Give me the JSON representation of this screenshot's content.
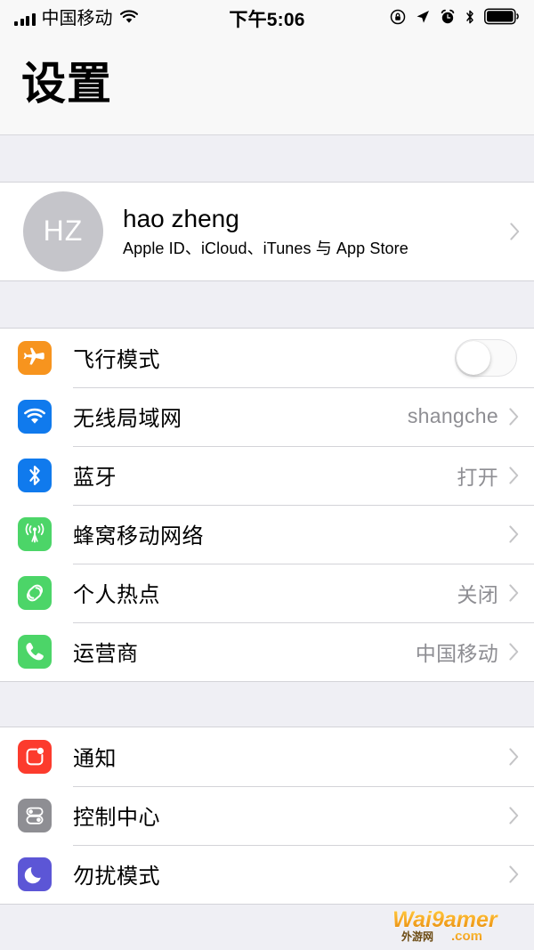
{
  "status_bar": {
    "carrier": "中国移动",
    "time": "下午5:06",
    "signal_icon": "signal-bars-icon",
    "wifi_icon": "wifi-icon",
    "rotation_lock_icon": "rotation-lock-icon",
    "location_icon": "location-arrow-icon",
    "alarm_icon": "alarm-clock-icon",
    "bluetooth_icon": "bluetooth-icon",
    "battery_icon": "battery-full-icon"
  },
  "nav": {
    "title": "设置"
  },
  "profile": {
    "initials": "HZ",
    "name": "hao zheng",
    "subtitle": "Apple ID、iCloud、iTunes 与 App Store",
    "chevron": "chevron-right-icon"
  },
  "groups": [
    {
      "id": "connectivity",
      "rows": [
        {
          "id": "airplane-mode",
          "icon": "airplane-icon",
          "color": "#F7941E",
          "label": "飞行模式",
          "value": "",
          "accessory": "toggle",
          "toggle_on": false
        },
        {
          "id": "wifi",
          "icon": "wifi-icon",
          "color": "#107AED",
          "label": "无线局域网",
          "value": "shangche",
          "accessory": "chevron"
        },
        {
          "id": "bluetooth",
          "icon": "bluetooth-icon",
          "color": "#107AED",
          "label": "蓝牙",
          "value": "打开",
          "accessory": "chevron"
        },
        {
          "id": "cellular",
          "icon": "cellular-antenna-icon",
          "color": "#4CD568",
          "label": "蜂窝移动网络",
          "value": "",
          "accessory": "chevron"
        },
        {
          "id": "personal-hotspot",
          "icon": "hotspot-links-icon",
          "color": "#4CD568",
          "label": "个人热点",
          "value": "关闭",
          "accessory": "chevron"
        },
        {
          "id": "carrier",
          "icon": "phone-handset-icon",
          "color": "#4CD568",
          "label": "运营商",
          "value": "中国移动",
          "accessory": "chevron"
        }
      ]
    },
    {
      "id": "system",
      "rows": [
        {
          "id": "notifications",
          "icon": "notification-badge-icon",
          "color": "#FC3B2D",
          "label": "通知",
          "value": "",
          "accessory": "chevron"
        },
        {
          "id": "control-center",
          "icon": "control-center-toggles-icon",
          "color": "#8E8E93",
          "label": "控制中心",
          "value": "",
          "accessory": "chevron"
        },
        {
          "id": "do-not-disturb",
          "icon": "crescent-moon-icon",
          "color": "#5C56D6",
          "label": "勿扰模式",
          "value": "",
          "accessory": "chevron"
        }
      ]
    }
  ],
  "watermark": {
    "main_text": "Wai9amer",
    "domain_text": ".com",
    "cn_text": "外游网",
    "color": "#F5A623"
  }
}
